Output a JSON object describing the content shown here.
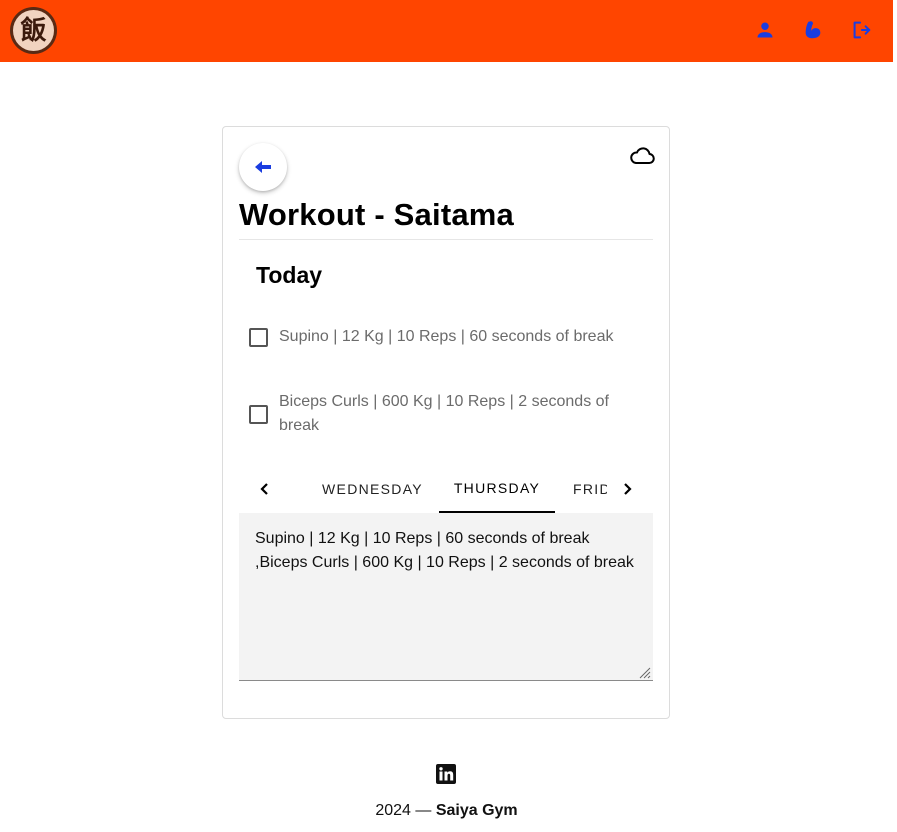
{
  "header": {
    "logo_text": "飯",
    "brand_color": "#ff4500",
    "icon_color": "#1a3de0",
    "nav_icons": [
      "profile-icon",
      "muscle-icon",
      "logout-icon"
    ]
  },
  "card": {
    "title": "Workout - Saitama",
    "back_icon": "arrow-left-icon",
    "cloud_icon": "cloud-icon",
    "section_title": "Today",
    "exercises": [
      {
        "label": "Supino | 12 Kg | 10 Reps | 60 seconds of break",
        "checked": false
      },
      {
        "label": "Biceps Curls | 600 Kg | 10 Reps | 2 seconds of break",
        "checked": false
      }
    ],
    "tabs": {
      "items": [
        "WEDNESDAY",
        "THURSDAY",
        "FRIDAY"
      ],
      "active": "THURSDAY"
    },
    "notes_value": "Supino | 12 Kg | 10 Reps | 60 seconds of break\n,Biceps Curls | 600 Kg | 10 Reps | 2 seconds of break"
  },
  "footer": {
    "social_icon": "linkedin-icon",
    "year_text": "2024 — ",
    "brand": "Saiya Gym"
  }
}
